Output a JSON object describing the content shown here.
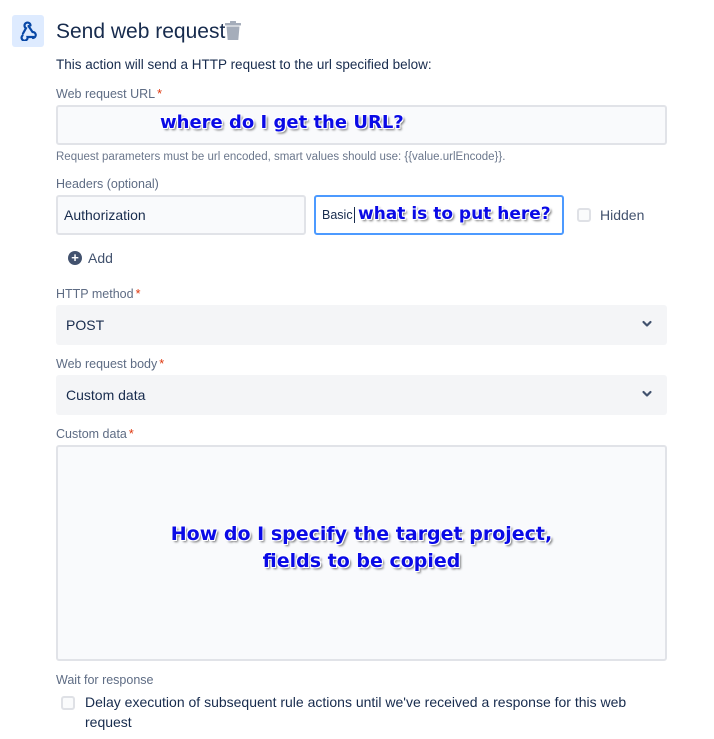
{
  "header": {
    "icon": "webhook-icon",
    "title": "Send web request",
    "delete_icon": "trash-icon",
    "description": "This action will send a HTTP request to the url specified below:"
  },
  "url_field": {
    "label": "Web request URL",
    "required_mark": "*",
    "value": "",
    "annotation": "where do I get the URL?",
    "hint": "Request parameters must be url encoded, smart values should use: {{value.urlEncode}}."
  },
  "headers": {
    "label": "Headers (optional)",
    "rows": [
      {
        "key": "Authorization",
        "value": "Basic ",
        "value_annotation": "what is to put here?",
        "hidden_label": "Hidden",
        "hidden_checked": false
      }
    ],
    "add_label": "Add",
    "add_icon": "add-circle-icon"
  },
  "http_method": {
    "label": "HTTP method",
    "required_mark": "*",
    "selected": "POST",
    "chevron_icon": "chevron-down-icon"
  },
  "body": {
    "label": "Web request body",
    "required_mark": "*",
    "selected": "Custom data",
    "chevron_icon": "chevron-down-icon"
  },
  "custom_data": {
    "label": "Custom data",
    "required_mark": "*",
    "value": "",
    "annotation_line1": "How do I specify the target project,",
    "annotation_line2": "fields to be copied"
  },
  "wait": {
    "label": "Wait for response",
    "checkbox_label": "Delay execution of subsequent rule actions until we've received a response for this web request",
    "checked": false
  },
  "colors": {
    "text_primary": "#172b4d",
    "label": "#5e6c84",
    "required": "#de350b",
    "focus_border": "#4c9aff",
    "annotation": "#0a0ae6",
    "icon_bg": "#deebff"
  }
}
